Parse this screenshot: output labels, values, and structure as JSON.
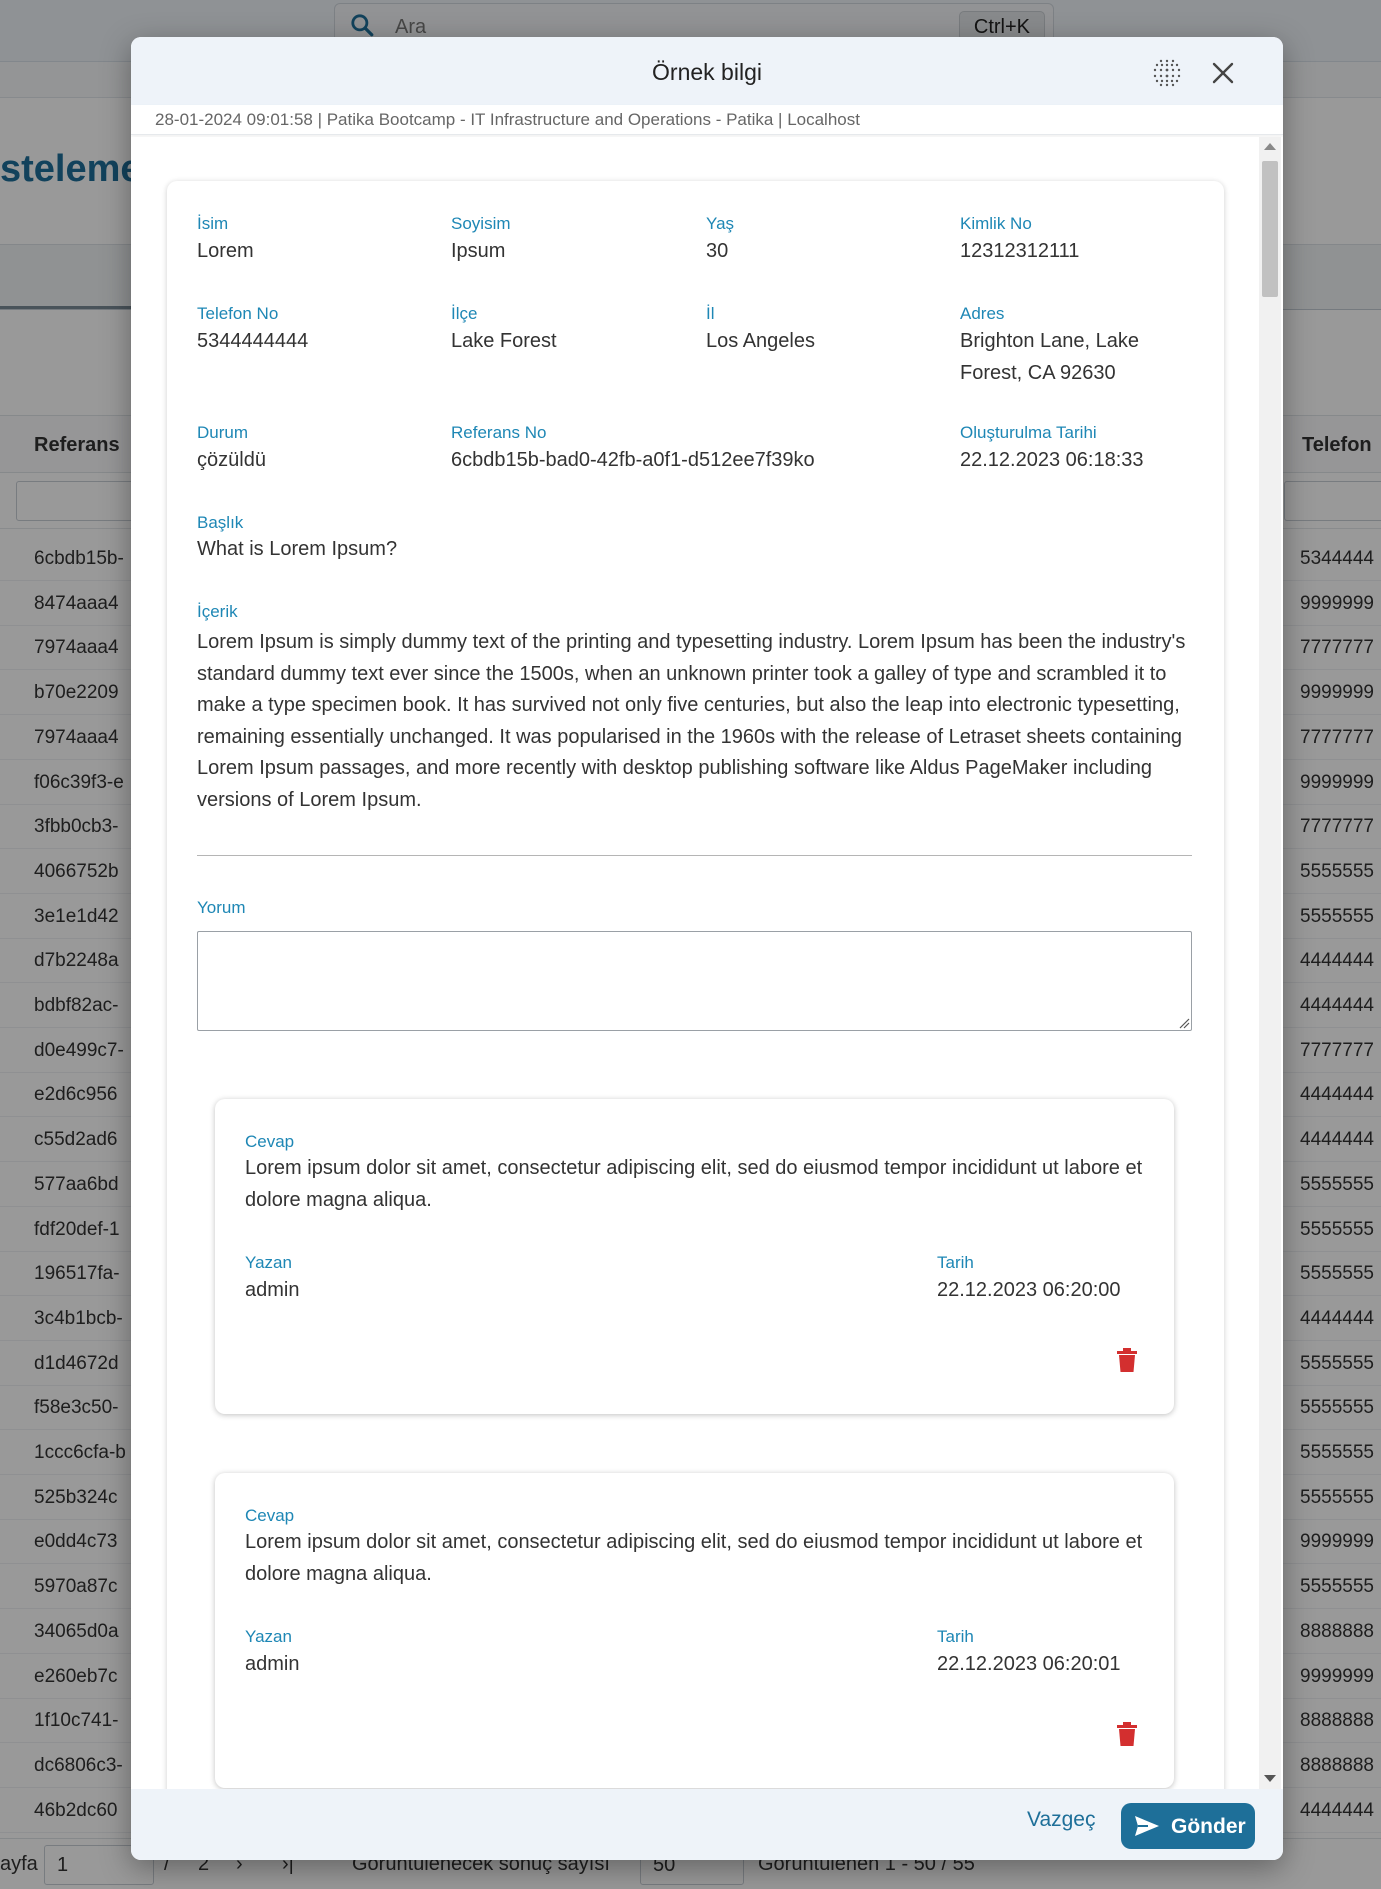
{
  "background": {
    "search_placeholder": "Ara",
    "search_shortcut": "Ctrl+K",
    "page_title": "steleme",
    "table_headers": {
      "col1": "Referans",
      "col2": "Telefon"
    },
    "rows": [
      {
        "ref": "6cbdb15b-",
        "phone": "5344444"
      },
      {
        "ref": "8474aaa4",
        "phone": "9999999"
      },
      {
        "ref": "7974aaa4",
        "phone": "7777777"
      },
      {
        "ref": "b70e2209",
        "phone": "9999999"
      },
      {
        "ref": "7974aaa4",
        "phone": "7777777"
      },
      {
        "ref": "f06c39f3-e",
        "phone": "9999999"
      },
      {
        "ref": "3fbb0cb3-",
        "phone": "7777777"
      },
      {
        "ref": "4066752b",
        "phone": "5555555"
      },
      {
        "ref": "3e1e1d42",
        "phone": "5555555"
      },
      {
        "ref": "d7b2248a",
        "phone": "4444444"
      },
      {
        "ref": "bdbf82ac-",
        "phone": "4444444"
      },
      {
        "ref": "d0e499c7-",
        "phone": "7777777"
      },
      {
        "ref": "e2d6c956",
        "phone": "4444444"
      },
      {
        "ref": "c55d2ad6",
        "phone": "4444444"
      },
      {
        "ref": "577aa6bd",
        "phone": "5555555"
      },
      {
        "ref": "fdf20def-1",
        "phone": "5555555"
      },
      {
        "ref": "196517fa-",
        "phone": "5555555"
      },
      {
        "ref": "3c4b1bcb-",
        "phone": "4444444"
      },
      {
        "ref": "d1d4672d",
        "phone": "5555555"
      },
      {
        "ref": "f58e3c50-",
        "phone": "5555555"
      },
      {
        "ref": "1ccc6cfa-b",
        "phone": "5555555"
      },
      {
        "ref": "525b324c",
        "phone": "5555555"
      },
      {
        "ref": "e0dd4c73",
        "phone": "9999999"
      },
      {
        "ref": "5970a87c",
        "phone": "5555555"
      },
      {
        "ref": "34065d0a",
        "phone": "8888888"
      },
      {
        "ref": "e260eb7c",
        "phone": "9999999"
      },
      {
        "ref": "1f10c741-",
        "phone": "8888888"
      },
      {
        "ref": "dc6806c3-",
        "phone": "8888888"
      },
      {
        "ref": "46b2dc60",
        "phone": "4444444"
      }
    ],
    "footer": {
      "page_label": "ayfa",
      "page_value": "1",
      "page_sep": "/",
      "total_pages": "2",
      "page_size_label": "Görüntülenecek sonuç sayısı",
      "page_size": "50",
      "shown": "Görüntülenen 1 - 50 / 55"
    }
  },
  "modal": {
    "title": "Örnek bilgi",
    "meta": "28-01-2024 09:01:58 | Patika Bootcamp - IT Infrastructure and Operations - Patika | Localhost",
    "fields": {
      "name": {
        "label": "İsim",
        "value": "Lorem"
      },
      "surname": {
        "label": "Soyisim",
        "value": "Ipsum"
      },
      "age": {
        "label": "Yaş",
        "value": "30"
      },
      "id_no": {
        "label": "Kimlik No",
        "value": "12312312111"
      },
      "phone": {
        "label": "Telefon No",
        "value": "5344444444"
      },
      "district": {
        "label": "İlçe",
        "value": "Lake Forest"
      },
      "city": {
        "label": "İl",
        "value": "Los Angeles"
      },
      "address": {
        "label": "Adres",
        "value": "Brighton Lane, Lake Forest, CA 92630"
      },
      "status": {
        "label": "Durum",
        "value": "çözüldü"
      },
      "ref_no": {
        "label": "Referans No",
        "value": "6cbdb15b-bad0-42fb-a0f1-d512ee7f39ko"
      },
      "created": {
        "label": "Oluşturulma Tarihi",
        "value": "22.12.2023 06:18:33"
      },
      "subject": {
        "label": "Başlık",
        "value": "What is Lorem Ipsum?"
      },
      "content": {
        "label": "İçerik",
        "value": "Lorem Ipsum is simply dummy text of the printing and typesetting industry. Lorem Ipsum has been the industry's standard dummy text ever since the 1500s, when an unknown printer took a galley of type and scrambled it to make a type specimen book. It has survived not only five centuries, but also the leap into electronic typesetting, remaining essentially unchanged. It was popularised in the 1960s with the release of Letraset sheets containing Lorem Ipsum passages, and more recently with desktop publishing software like Aldus PageMaker including versions of Lorem Ipsum."
      }
    },
    "comment_label": "Yorum",
    "comment_value": "",
    "answers": [
      {
        "answer_label": "Cevap",
        "text": "Lorem ipsum dolor sit amet, consectetur adipiscing elit, sed do eiusmod tempor incididunt ut labore et dolore magna aliqua.",
        "author_label": "Yazan",
        "author": "admin",
        "date_label": "Tarih",
        "date": "22.12.2023 06:20:00"
      },
      {
        "answer_label": "Cevap",
        "text": "Lorem ipsum dolor sit amet, consectetur adipiscing elit, sed do eiusmod tempor incididunt ut labore et dolore magna aliqua.",
        "author_label": "Yazan",
        "author": "admin",
        "date_label": "Tarih",
        "date": "22.12.2023 06:20:01"
      }
    ],
    "cancel_label": "Vazgeç",
    "send_label": "Gönder"
  },
  "colors": {
    "accent": "#1e6f99",
    "label": "#1e87b5",
    "delete": "#d32f2f"
  },
  "icons": [
    "search-icon",
    "grid-dots-icon",
    "close-icon",
    "trash-icon",
    "send-icon",
    "resize-grip-icon"
  ]
}
